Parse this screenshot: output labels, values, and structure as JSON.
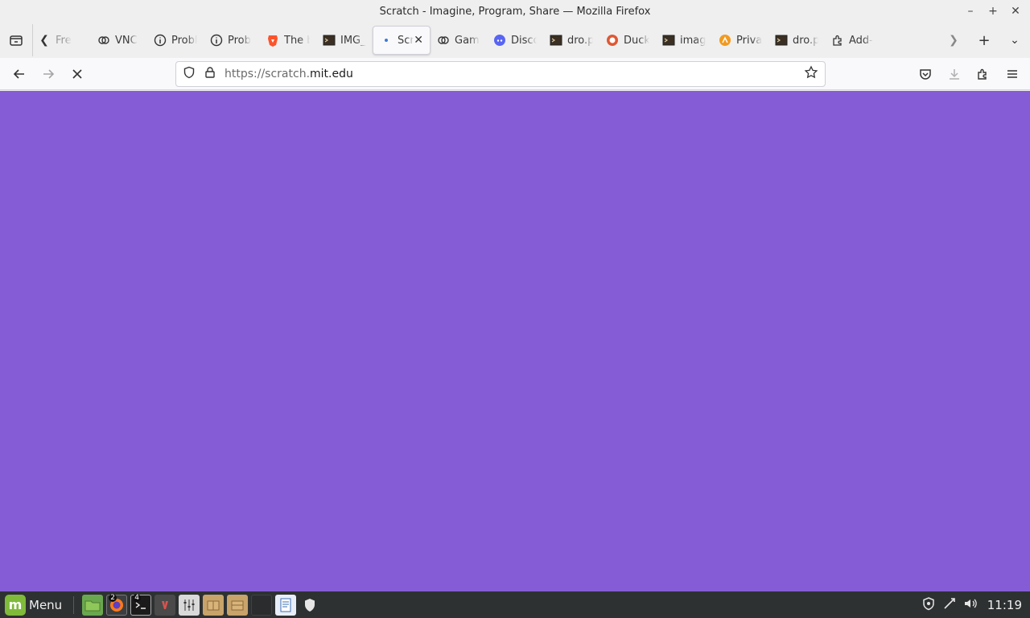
{
  "window": {
    "title": "Scratch - Imagine, Program, Share — Mozilla Firefox"
  },
  "tabs": [
    {
      "label": "Fre",
      "icon": "back-arrow"
    },
    {
      "label": "VNC",
      "icon": "vnc-icon"
    },
    {
      "label": "Probl",
      "icon": "info-icon"
    },
    {
      "label": "Prob",
      "icon": "info-icon"
    },
    {
      "label": "The b",
      "icon": "brave-icon"
    },
    {
      "label": "IMG_",
      "icon": "terminal-icon"
    },
    {
      "label": "Scr",
      "icon": "loading-dot",
      "active": true
    },
    {
      "label": "Gam",
      "icon": "vnc-icon"
    },
    {
      "label": "Disco",
      "icon": "discord-icon"
    },
    {
      "label": "dro.p",
      "icon": "terminal-icon"
    },
    {
      "label": "Duck",
      "icon": "duckduckgo-icon"
    },
    {
      "label": "imag",
      "icon": "terminal-icon"
    },
    {
      "label": "Priva",
      "icon": "privacy-icon"
    },
    {
      "label": "dro.p",
      "icon": "terminal-icon"
    },
    {
      "label": "Add-",
      "icon": "puzzle-icon"
    }
  ],
  "navbar": {
    "url_prefix": "https://scratch.",
    "url_domain": "mit.edu"
  },
  "content": {
    "background": "#855cd6"
  },
  "taskbar": {
    "menu_label": "Menu",
    "firefox_badge": "2",
    "terminal_badge": "4",
    "clock": "11:19"
  }
}
